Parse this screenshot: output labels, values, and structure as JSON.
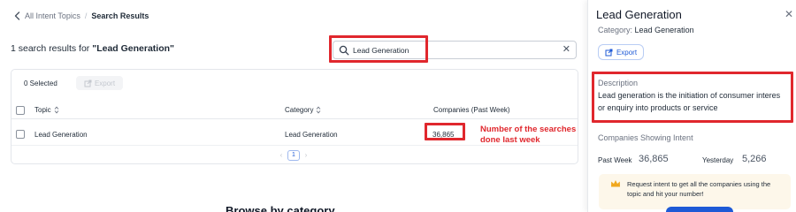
{
  "breadcrumb": {
    "parent": "All Intent Topics",
    "separator": "/",
    "current": "Search Results"
  },
  "results": {
    "prefix": "1 search results for",
    "query": "\"Lead Generation\""
  },
  "search": {
    "value": "Lead Generation",
    "clear": "✕"
  },
  "toolbar": {
    "selected": "0 Selected",
    "export": "Export"
  },
  "table": {
    "columns": [
      "Topic",
      "Category",
      "Companies (Past Week)"
    ],
    "rows": [
      {
        "topic": "Lead Generation",
        "category": "Lead Generation",
        "companies": "36,865"
      }
    ]
  },
  "pagination": {
    "prev": "‹",
    "page": "1",
    "next": "›"
  },
  "annotation": "Number of the searches done last week",
  "browse_heading": "Browse by category",
  "panel": {
    "title": "Lead Generation",
    "close": "✕",
    "category_label": "Category:",
    "category_value": "Lead Generation",
    "export": "Export",
    "description_label": "Description",
    "description_line1": "Lead generation is the initiation of consumer interes",
    "description_line2": "or enquiry into products or service",
    "intent_label": "Companies Showing Intent",
    "past_week_label": "Past Week",
    "past_week_value": "36,865",
    "yesterday_label": "Yesterday",
    "yesterday_value": "5,266",
    "promo_text": "Request intent to get all the companies using the topic and hit your number!"
  },
  "colors": {
    "accent": "#1e5ad6",
    "annotation_red": "#e0272d",
    "promo_bg": "#fdf7ea",
    "crown": "#f0a81e"
  }
}
